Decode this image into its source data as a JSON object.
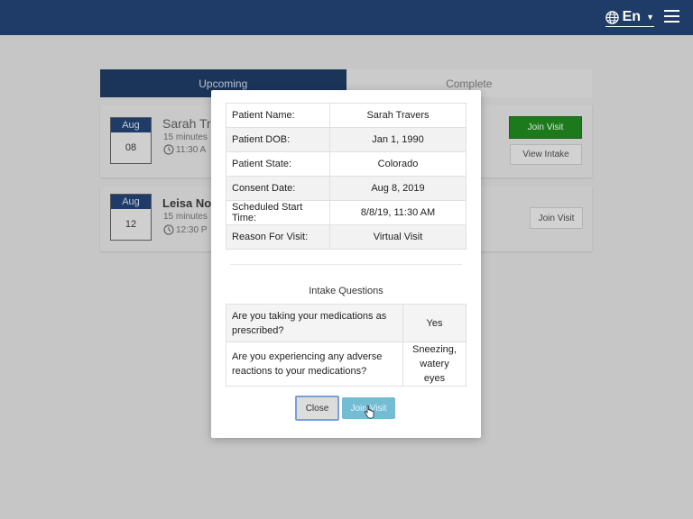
{
  "header": {
    "language": "En",
    "language_icon": "globe-icon",
    "menu_icon": "hamburger-icon"
  },
  "tabs": [
    {
      "label": "Upcoming",
      "active": true
    },
    {
      "label": "Complete",
      "active": false
    }
  ],
  "appointments": [
    {
      "month": "Aug",
      "day": "08",
      "name": "Sarah Tra",
      "duration": "15 minutes",
      "time": "11:30 A",
      "join_label": "Join Visit",
      "intake_label": "View Intake"
    },
    {
      "month": "Aug",
      "day": "12",
      "name": "Leisa Norr",
      "duration": "15 minutes",
      "time": "12:30 P",
      "join_label": "Join Visit"
    }
  ],
  "modal": {
    "info_rows": [
      {
        "label": "Patient Name:",
        "value": "Sarah Travers"
      },
      {
        "label": "Patient DOB:",
        "value": "Jan 1, 1990"
      },
      {
        "label": "Patient State:",
        "value": "Colorado"
      },
      {
        "label": "Consent Date:",
        "value": "Aug 8, 2019"
      },
      {
        "label": "Scheduled Start Time:",
        "value": "8/8/19, 11:30 AM"
      },
      {
        "label": "Reason For Visit:",
        "value": "Virtual Visit"
      }
    ],
    "intake_title": "Intake Questions",
    "questions": [
      {
        "q": "Are you taking your medications as prescribed?",
        "a": "Yes"
      },
      {
        "q": "Are you experiencing any adverse reactions to your medications?",
        "a": "Sneezing, watery eyes"
      }
    ],
    "close_label": "Close",
    "join_label": "Join Visit"
  },
  "colors": {
    "header_bg": "#1f3c69",
    "tab_active_bg": "#1b3559",
    "join_green": "#1c7a1c",
    "modal_join": "#72bcd4"
  }
}
